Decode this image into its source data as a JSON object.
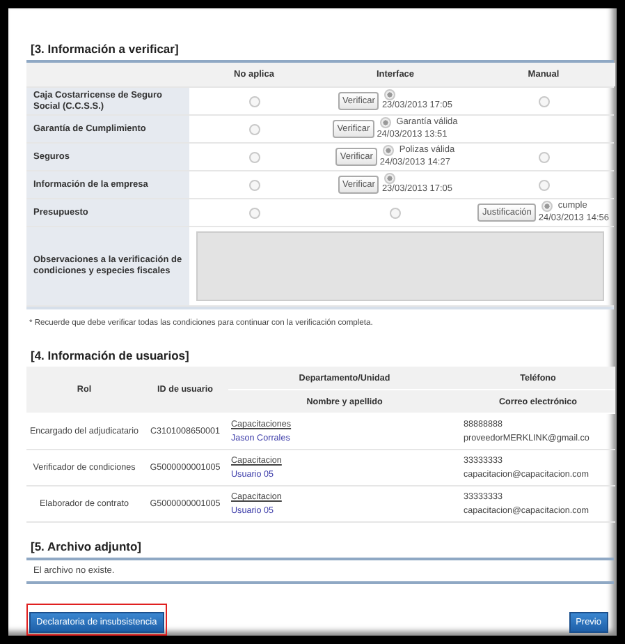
{
  "verification": {
    "title": "[3. Información a verificar]",
    "columns": [
      "No aplica",
      "Interface",
      "Manual"
    ],
    "rows": [
      {
        "label": "Caja Costarricense de Seguro Social (C.C.S.S.)",
        "cells": [
          {
            "kind": "radio",
            "selected": false
          },
          {
            "kind": "action",
            "button": "Verificar",
            "selected": true,
            "date": "23/03/2013 17:05"
          },
          {
            "kind": "radio",
            "selected": false
          }
        ]
      },
      {
        "label": "Garantía de Cumplimiento",
        "cells": [
          {
            "kind": "radio",
            "selected": false
          },
          {
            "kind": "action",
            "button": "Verificar",
            "selected": true,
            "status": "Garantía válida",
            "date": "24/03/2013 13:51"
          },
          {
            "kind": "empty"
          }
        ]
      },
      {
        "label": "Seguros",
        "cells": [
          {
            "kind": "radio",
            "selected": false
          },
          {
            "kind": "action",
            "button": "Verificar",
            "selected": true,
            "status": "Polizas válida",
            "date": "24/03/2013 14:27"
          },
          {
            "kind": "radio",
            "selected": false
          }
        ]
      },
      {
        "label": "Información de la empresa",
        "cells": [
          {
            "kind": "radio",
            "selected": false
          },
          {
            "kind": "action",
            "button": "Verificar",
            "selected": true,
            "date": "23/03/2013 17:05"
          },
          {
            "kind": "radio",
            "selected": false
          }
        ]
      },
      {
        "label": "Presupuesto",
        "cells": [
          {
            "kind": "radio",
            "selected": false
          },
          {
            "kind": "radio",
            "selected": false
          },
          {
            "kind": "action",
            "button": "Justificación",
            "selected": true,
            "status": "cumple",
            "date": "24/03/2013 14:56"
          }
        ]
      }
    ],
    "observations": {
      "label": "Observaciones a la verificación de condiciones y especies fiscales",
      "disabled": true
    },
    "note": "* Recuerde que debe verificar todas las condiciones para continuar con la verificación completa."
  },
  "users": {
    "title": "[4. Información de usuarios]",
    "columns": [
      "Rol",
      "ID de usuario",
      "Departamento/Unidad",
      "Nombre y apellido",
      "Teléfono",
      "Correo electrónico"
    ],
    "rows": [
      {
        "role": "Encargado del adjudicatario",
        "id": "C3101008650001",
        "department": "Capacitaciones",
        "name": "Jason Corrales",
        "phone": "88888888",
        "email": "proveedorMERKLINK@gmail.co"
      },
      {
        "role": "Verificador de condiciones",
        "id": "G5000000001005",
        "department": "Capacitacion",
        "name": "Usuario 05",
        "phone": "33333333",
        "email": "capacitacion@capacitacion.com"
      },
      {
        "role": "Elaborador de contrato",
        "id": "G5000000001005",
        "department": "Capacitacion",
        "name": "Usuario 05",
        "phone": "33333333",
        "email": "capacitacion@capacitacion.com"
      }
    ]
  },
  "attachment": {
    "title": "[5. Archivo adjunto]",
    "message": "El archivo no existe."
  },
  "buttons": [
    {
      "label": "Declaratoria de insubsistencia",
      "highlighted": true
    },
    {
      "label": "Previo",
      "highlighted": false
    }
  ]
}
